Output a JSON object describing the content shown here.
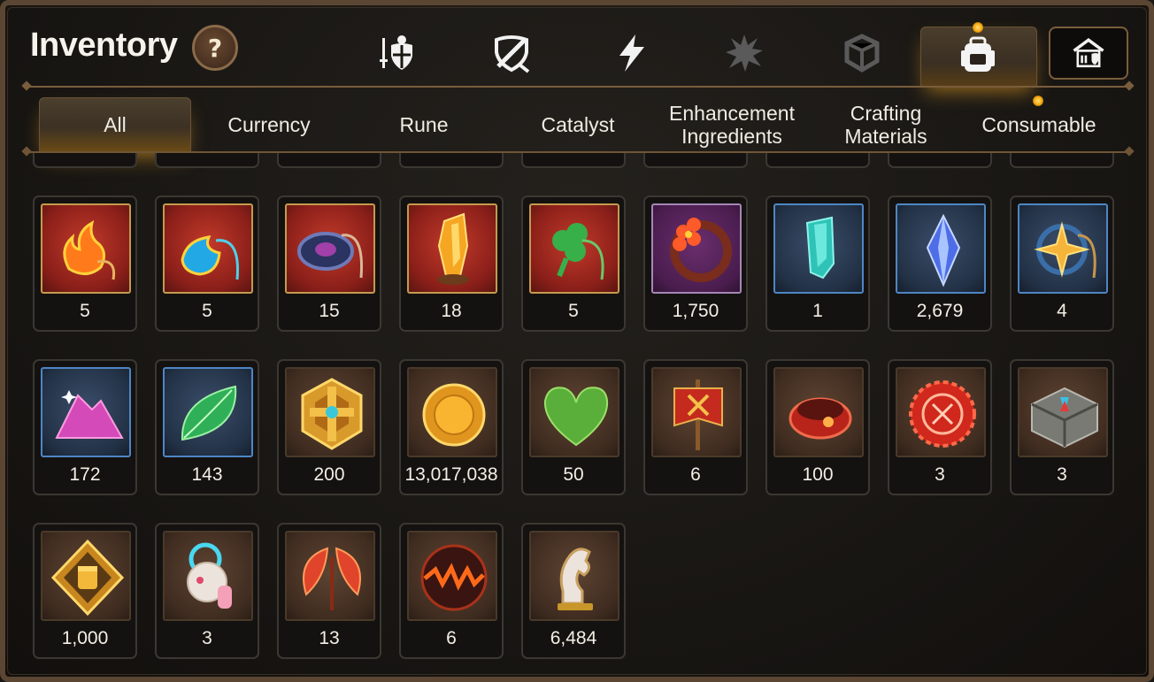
{
  "header": {
    "title": "Inventory",
    "help_label": "?",
    "category_icons": [
      "sword-shield-icon",
      "crossed-sword-shield-icon",
      "lightning-icon",
      "burst-icon",
      "cube-icon",
      "backpack-icon"
    ],
    "selected_category": "backpack-icon",
    "guild_icon": "guild-hall-icon"
  },
  "tabs": [
    {
      "label": "All",
      "active": true
    },
    {
      "label": "Currency",
      "active": false
    },
    {
      "label": "Rune",
      "active": false
    },
    {
      "label": "Catalyst",
      "active": false
    },
    {
      "label": "Enhancement Ingredients",
      "active": false
    },
    {
      "label": "Crafting Materials",
      "active": false
    },
    {
      "label": "Consumable",
      "active": false
    }
  ],
  "items": [
    {
      "icon": "fire-charm-icon",
      "count": "5"
    },
    {
      "icon": "water-charm-icon",
      "count": "5"
    },
    {
      "icon": "dark-charm-icon",
      "count": "15"
    },
    {
      "icon": "amber-crystal-icon",
      "count": "18"
    },
    {
      "icon": "clover-charm-icon",
      "count": "5"
    },
    {
      "icon": "flower-charm-icon",
      "count": "1,750"
    },
    {
      "icon": "teal-crystal-icon",
      "count": "1"
    },
    {
      "icon": "blue-gem-icon",
      "count": "2,679"
    },
    {
      "icon": "star-charm-icon",
      "count": "4"
    },
    {
      "icon": "pink-ore-icon",
      "count": "172"
    },
    {
      "icon": "green-leaf-icon",
      "count": "143"
    },
    {
      "icon": "gold-emblem-icon",
      "count": "200"
    },
    {
      "icon": "gold-coin-icon",
      "count": "13,017,038"
    },
    {
      "icon": "green-heart-icon",
      "count": "50"
    },
    {
      "icon": "banner-icon",
      "count": "6"
    },
    {
      "icon": "red-ring-icon",
      "count": "100"
    },
    {
      "icon": "red-seal-icon",
      "count": "3"
    },
    {
      "icon": "stone-box-icon",
      "count": "3"
    },
    {
      "icon": "fist-badge-icon",
      "count": "1,000"
    },
    {
      "icon": "robot-icon",
      "count": "3"
    },
    {
      "icon": "red-leaf-icon",
      "count": "13"
    },
    {
      "icon": "lava-orb-icon",
      "count": "6"
    },
    {
      "icon": "knight-chess-icon",
      "count": "6,484"
    }
  ],
  "colors": {
    "frame": "#5a4632",
    "gold_frame": "#c49a4f",
    "blue_frame": "#4e86c4",
    "accent_glow": "#f6a60a"
  }
}
